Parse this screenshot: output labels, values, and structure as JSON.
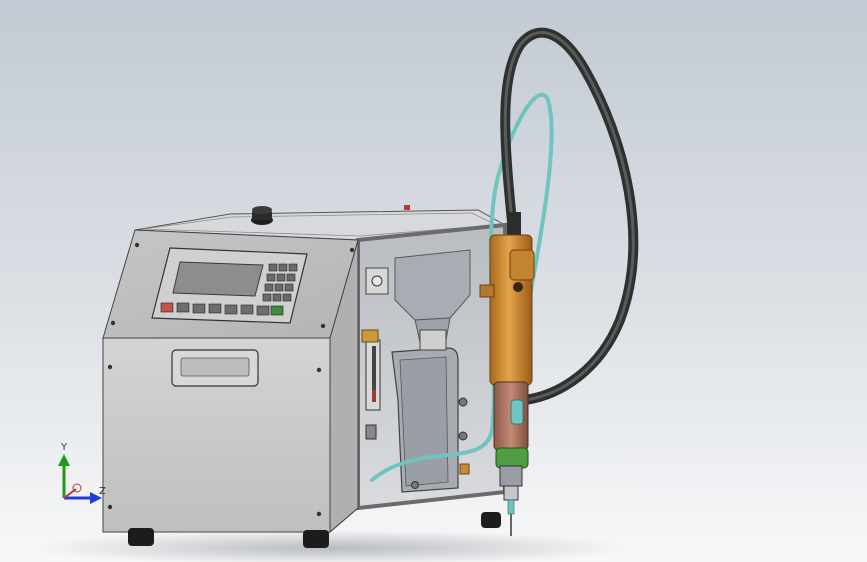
{
  "triad": {
    "y_label": "Y",
    "z_label": "Z"
  },
  "colors": {
    "background_top": "#c3cad3",
    "background_bottom": "#f7f8f9",
    "enclosure": "#c9c9c9",
    "control_panel": "#bdbdbd",
    "lcd_screen": "#8d8d8d",
    "brass_body": "#c98a2c",
    "green_collar": "#4e9e44",
    "hose_dark": "#3a3b3b",
    "hose_teal": "#6fc4c0",
    "axis_y": "#1f9a1f",
    "axis_z": "#1f3fd6"
  }
}
